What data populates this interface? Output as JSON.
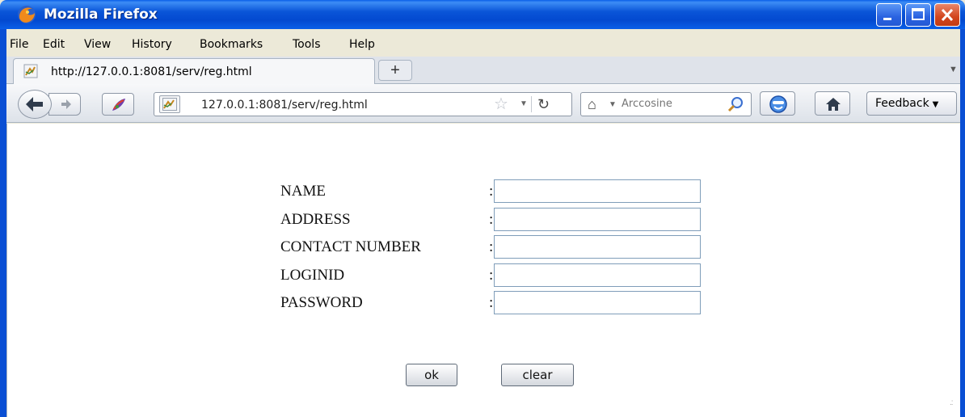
{
  "window": {
    "title": "Mozilla Firefox",
    "colors": {
      "titlebar": "#0a55d8",
      "close": "#d2451d"
    }
  },
  "menu": [
    "File",
    "Edit",
    "View",
    "History",
    "Bookmarks",
    "Tools",
    "Help"
  ],
  "tab": {
    "title": "http://127.0.0.1:8081/serv/reg.html",
    "new_tab": "+"
  },
  "nav": {
    "url": "127.0.0.1:8081/serv/reg.html",
    "search_placeholder": "Arccosine",
    "feedback_label": "Feedback",
    "icons": [
      "back-icon",
      "forward-icon",
      "addon-icon",
      "page-icon",
      "star-icon",
      "reload-icon",
      "home-icon",
      "magnifier-icon",
      "smiley-icon"
    ]
  },
  "form": {
    "fields": [
      {
        "label": "NAME",
        "colon": ":",
        "value": ""
      },
      {
        "label": "ADDRESS",
        "colon": ":",
        "value": ""
      },
      {
        "label": "CONTACT NUMBER",
        "colon": ":",
        "value": ""
      },
      {
        "label": "LOGINID",
        "colon": ":",
        "value": ""
      },
      {
        "label": "PASSWORD",
        "colon": ":",
        "value": ""
      }
    ],
    "ok_label": "ok",
    "clear_label": "clear"
  }
}
